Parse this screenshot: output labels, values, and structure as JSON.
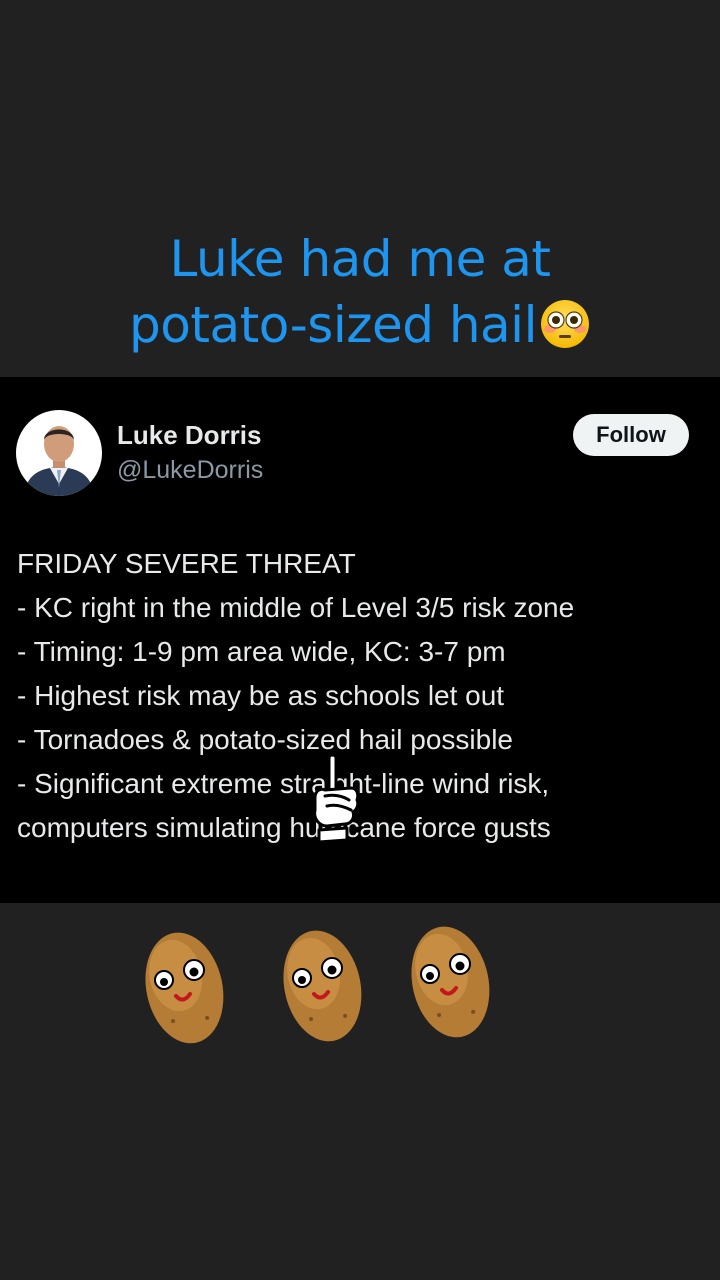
{
  "caption": {
    "line1": "Luke had me at",
    "line2": "potato-sized hail",
    "emoji_icon": "flushed-face-icon",
    "color": "#1e95ee"
  },
  "tweet": {
    "display_name": "Luke Dorris",
    "handle": "@LukeDorris",
    "follow_label": "Follow",
    "lines": [
      "FRIDAY SEVERE THREAT",
      "- KC right in the middle of Level 3/5 risk zone",
      "- Timing: 1-9 pm area wide, KC: 3-7 pm",
      "- Highest risk may be as schools let out",
      "- Tornadoes & potato-sized hail possible",
      "- Significant extreme straight-line wind risk,",
      "computers simulating hurricane force gusts"
    ]
  },
  "stickers": {
    "pointer_icon": "pointing-hand-icon",
    "potato_icon": "smiling-potato-icon",
    "potato_count": 3
  },
  "colors": {
    "background": "#212121",
    "card": "#000000",
    "text": "#e7e9ea",
    "secondary_text": "#8b98a5"
  }
}
